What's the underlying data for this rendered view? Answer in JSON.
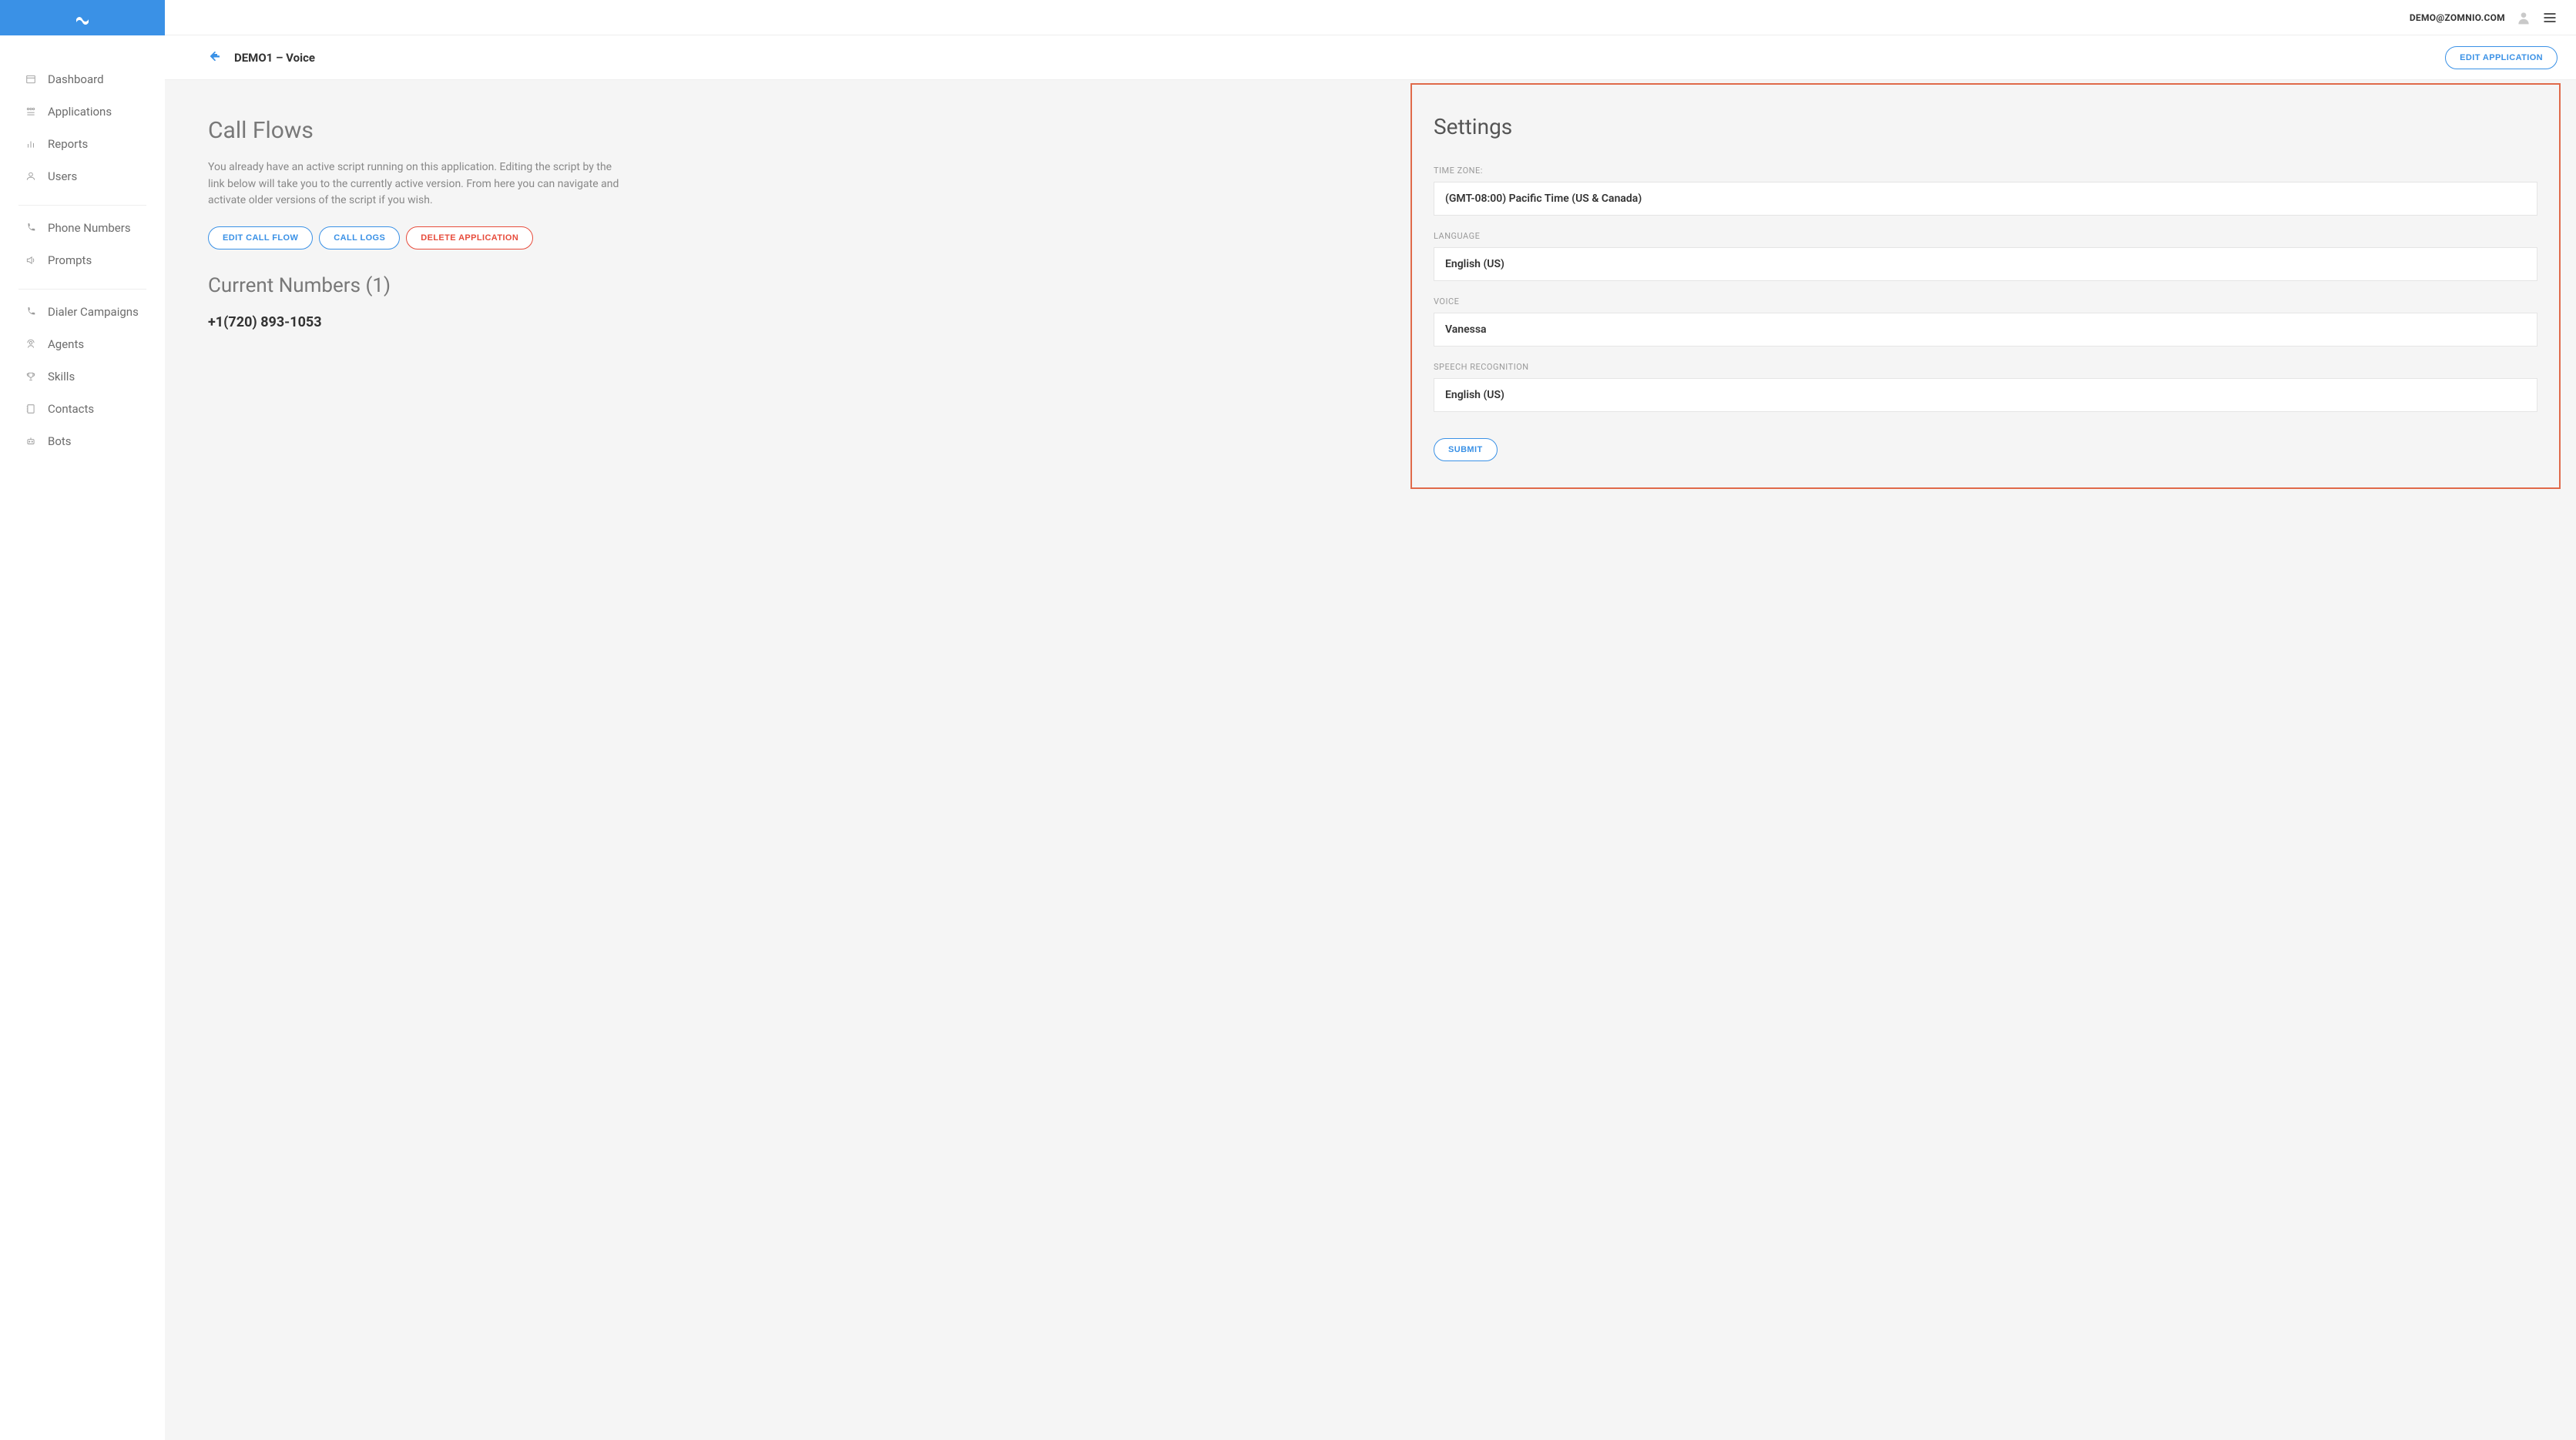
{
  "header": {
    "user_email": "DEMO@ZOMNIO.COM"
  },
  "sidebar": {
    "groups": [
      {
        "items": [
          {
            "label": "Dashboard",
            "icon": "dashboard"
          },
          {
            "label": "Applications",
            "icon": "apps"
          },
          {
            "label": "Reports",
            "icon": "chart"
          },
          {
            "label": "Users",
            "icon": "user"
          }
        ]
      },
      {
        "items": [
          {
            "label": "Phone Numbers",
            "icon": "phone"
          },
          {
            "label": "Prompts",
            "icon": "speaker"
          }
        ]
      },
      {
        "items": [
          {
            "label": "Dialer Campaigns",
            "icon": "phone"
          },
          {
            "label": "Agents",
            "icon": "agent"
          },
          {
            "label": "Skills",
            "icon": "trophy"
          },
          {
            "label": "Contacts",
            "icon": "contacts"
          },
          {
            "label": "Bots",
            "icon": "bot"
          }
        ]
      }
    ]
  },
  "page": {
    "title": "DEMO1 – Voice",
    "edit_app_label": "EDIT APPLICATION"
  },
  "callflows": {
    "heading": "Call Flows",
    "description": "You already have an active script running on this application. Editing the script by the link below will take you to the currently active version. From here you can navigate and activate older versions of the script if you wish.",
    "edit_call_flow_label": "EDIT CALL FLOW",
    "call_logs_label": "CALL LOGS",
    "delete_app_label": "DELETE APPLICATION",
    "current_numbers_heading": "Current Numbers (1)",
    "numbers": [
      "+1(720) 893-1053"
    ]
  },
  "settings": {
    "heading": "Settings",
    "timezone_label": "TIME ZONE:",
    "timezone_value": "(GMT-08:00) Pacific Time (US & Canada)",
    "language_label": "LANGUAGE",
    "language_value": "English (US)",
    "voice_label": "VOICE",
    "voice_value": "Vanessa",
    "speechrec_label": "SPEECH RECOGNITION",
    "speechrec_value": "English (US)",
    "submit_label": "SUBMIT"
  }
}
